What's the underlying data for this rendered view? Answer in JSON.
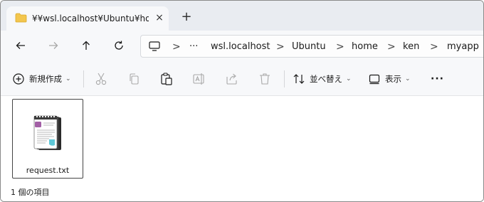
{
  "tab": {
    "title": "¥¥wsl.localhost¥Ubuntu¥home¥ken¥myapp",
    "close": "×",
    "add": "+"
  },
  "nav": {
    "back": "←",
    "forward": "→",
    "up": "↑",
    "refresh": "↻"
  },
  "breadcrumb": {
    "more": "···",
    "separator": ">",
    "items": [
      "wsl.localhost",
      "Ubuntu",
      "home",
      "ken",
      "myapp"
    ]
  },
  "toolbar": {
    "new_label": "新規作成",
    "sort_label": "並べ替え",
    "view_label": "表示",
    "more_label": "···",
    "caret": "⌄"
  },
  "files": [
    {
      "name": "request.txt",
      "icon": "notepad-icon",
      "selected": true
    }
  ],
  "status": {
    "text": "1 個の項目"
  },
  "colors": {
    "tab_strip": "#e9ecf1",
    "toolbar_bg": "#f7f8fa",
    "folder": "#f3c64e",
    "notepad_purple": "#a25fa5",
    "notepad_teal": "#5ec8d8"
  }
}
